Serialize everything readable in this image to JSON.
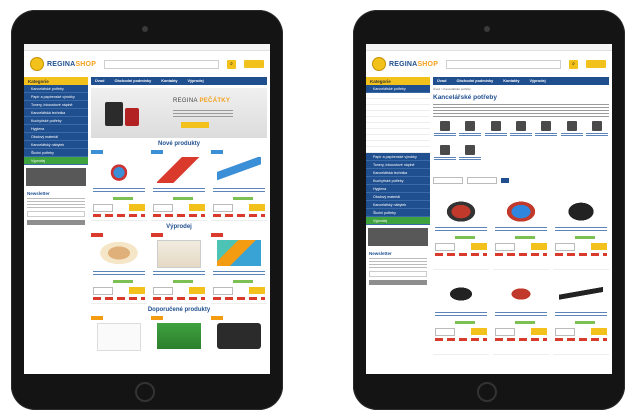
{
  "brand": {
    "part1": "REGINA",
    "part2": "SHOP"
  },
  "search_placeholder": "",
  "left": {
    "categories_heading": "Kategorie",
    "categories": [
      "Kancelářské potřeby",
      "Papír a papírenské výrobky",
      "Tonery, inkoustové náplně",
      "Kancelářská technika",
      "Kuchyňské potřeby",
      "Hygiena",
      "Obalový materiál",
      "Kancelářský nábytek",
      "Školní potřeby",
      "Výprodej"
    ],
    "sidebar_box_title": "Newsletter",
    "nav": [
      "Úvod",
      "Obchodní podmínky",
      "Kontakty",
      "Výprodej"
    ],
    "banner_title_part1": "REGINA",
    "banner_title_part2": "PEČÁTKY",
    "sections": [
      "Nové produkty",
      "Výprodej",
      "Doporučené produkty"
    ]
  },
  "right": {
    "breadcrumb": "Úvod > Kancelářské potřeby",
    "page_title": "Kancelářské potřeby",
    "sidebar_box_title": "Newsletter"
  },
  "colors": {
    "brand_blue": "#1f4f8f",
    "brand_yellow": "#f3c11b",
    "accent_green": "#3ea23e",
    "sale_red": "#d93a2b"
  }
}
